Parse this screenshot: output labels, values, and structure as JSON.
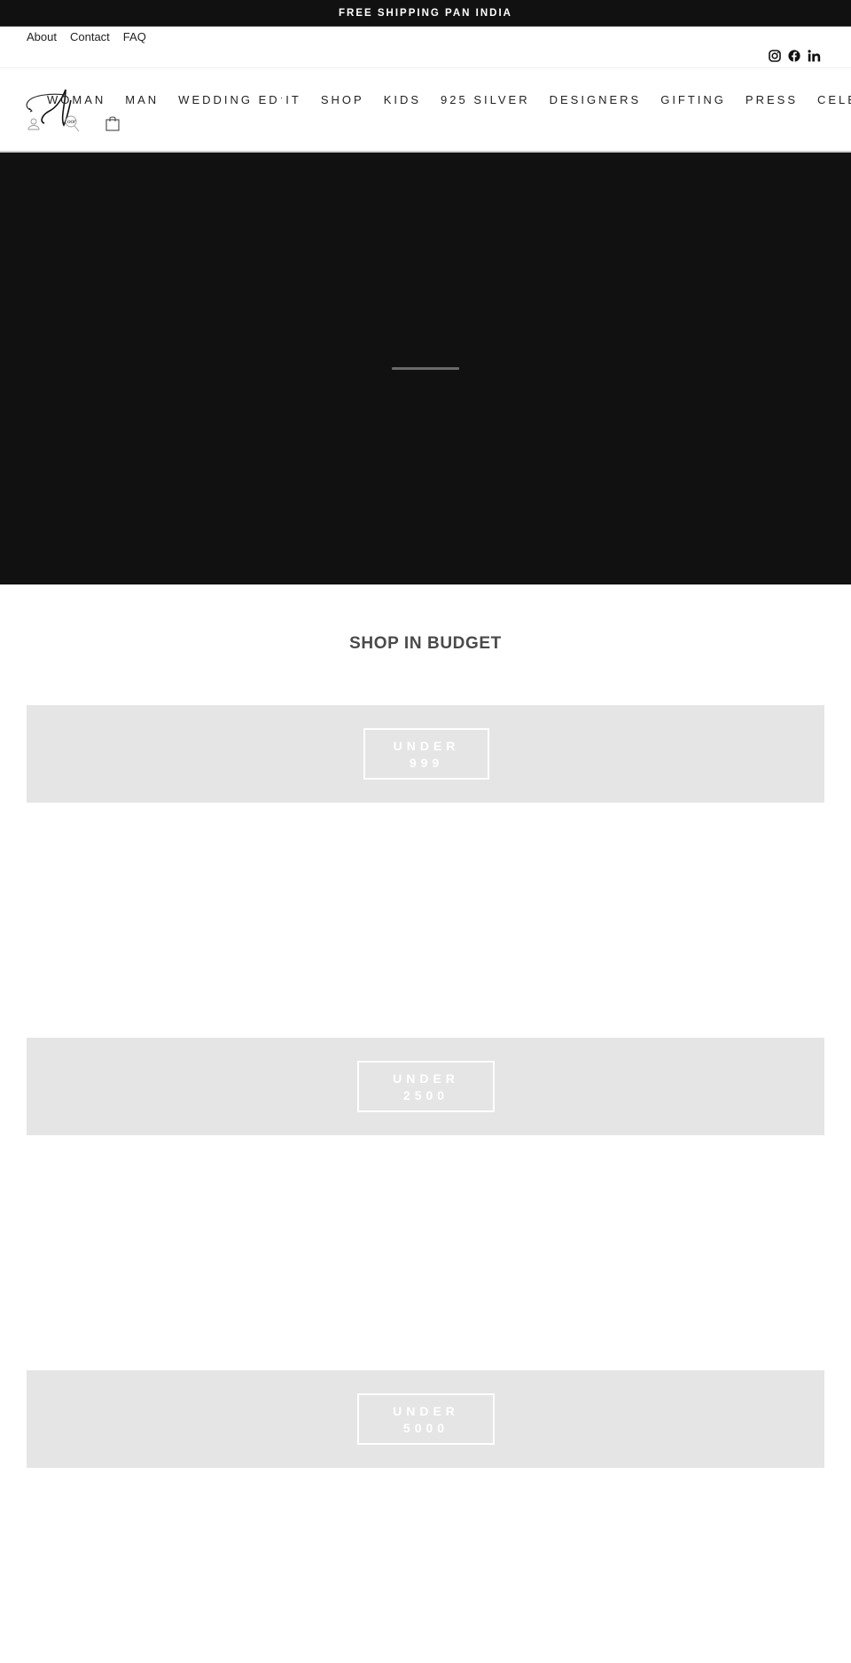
{
  "announcement": "FREE SHIPPING PAN INDIA",
  "top_links": [
    "About",
    "Contact",
    "FAQ"
  ],
  "social": [
    "instagram-icon",
    "facebook-icon",
    "linkedin-icon"
  ],
  "logo": {
    "alt": "Noor logo"
  },
  "nav": [
    "WOMAN",
    "MAN",
    "WEDDING EDˑIT",
    "SHOP",
    "KIDS",
    "925 SILVER",
    "DESIGNERS",
    "GIFTING",
    "PRESS",
    "CELEB STYLE"
  ],
  "hero": {
    "state": "loading"
  },
  "budget": {
    "title": "SHOP IN BUDGET",
    "cards": [
      {
        "line1": "UNDER",
        "line2": "999"
      },
      {
        "line1": "UNDER",
        "line2": "2500"
      },
      {
        "line1": "UNDER",
        "line2": "5000"
      }
    ]
  },
  "colors": {
    "announcement_bg": "#111111",
    "hero_bg": "#111111",
    "card_bg": "#e5e5e5",
    "title": "#4a4a4a"
  }
}
